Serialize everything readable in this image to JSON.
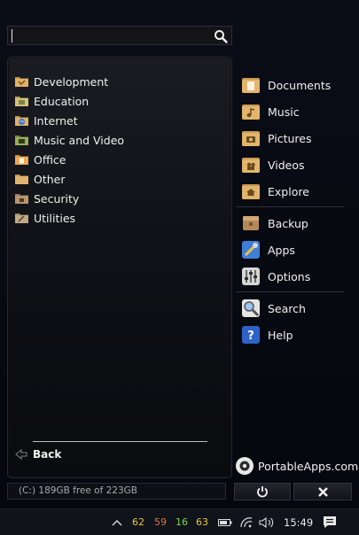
{
  "search": {
    "placeholder": "",
    "icon": "search-icon"
  },
  "categories": [
    {
      "label": "Development",
      "icon": "development-folder-icon",
      "color": "#c79447"
    },
    {
      "label": "Education",
      "icon": "education-folder-icon",
      "color": "#b9a257"
    },
    {
      "label": "Internet",
      "icon": "internet-folder-icon",
      "color": "#5b86c9"
    },
    {
      "label": "Music and Video",
      "icon": "music-video-folder-icon",
      "color": "#7a8a42"
    },
    {
      "label": "Office",
      "icon": "office-folder-icon",
      "color": "#d18c3a"
    },
    {
      "label": "Other",
      "icon": "other-folder-icon",
      "color": "#c49552"
    },
    {
      "label": "Security",
      "icon": "security-folder-icon",
      "color": "#9a7a55"
    },
    {
      "label": "Utilities",
      "icon": "utilities-folder-icon",
      "color": "#a08a6a"
    }
  ],
  "back": {
    "label": "Back"
  },
  "right_panel": {
    "folders": [
      {
        "label": "Documents",
        "icon": "documents-icon"
      },
      {
        "label": "Music",
        "icon": "music-icon"
      },
      {
        "label": "Pictures",
        "icon": "pictures-icon"
      },
      {
        "label": "Videos",
        "icon": "videos-icon"
      },
      {
        "label": "Explore",
        "icon": "explore-icon"
      }
    ],
    "tools": [
      {
        "label": "Backup",
        "icon": "backup-icon"
      },
      {
        "label": "Apps",
        "icon": "apps-icon"
      },
      {
        "label": "Options",
        "icon": "options-icon"
      }
    ],
    "help": [
      {
        "label": "Search",
        "icon": "search-magnifier-icon"
      },
      {
        "label": "Help",
        "icon": "help-icon"
      }
    ]
  },
  "brand": {
    "label": "PortableApps.com"
  },
  "drive": {
    "text": "(C:) 189GB free of 223GB"
  },
  "taskbar": {
    "numbers": [
      {
        "value": "62",
        "color": "#e8c33a"
      },
      {
        "value": "59",
        "color": "#e0734a"
      },
      {
        "value": "16",
        "color": "#7ad65a"
      },
      {
        "value": "63",
        "color": "#e8c33a"
      }
    ],
    "time": "15:49"
  }
}
